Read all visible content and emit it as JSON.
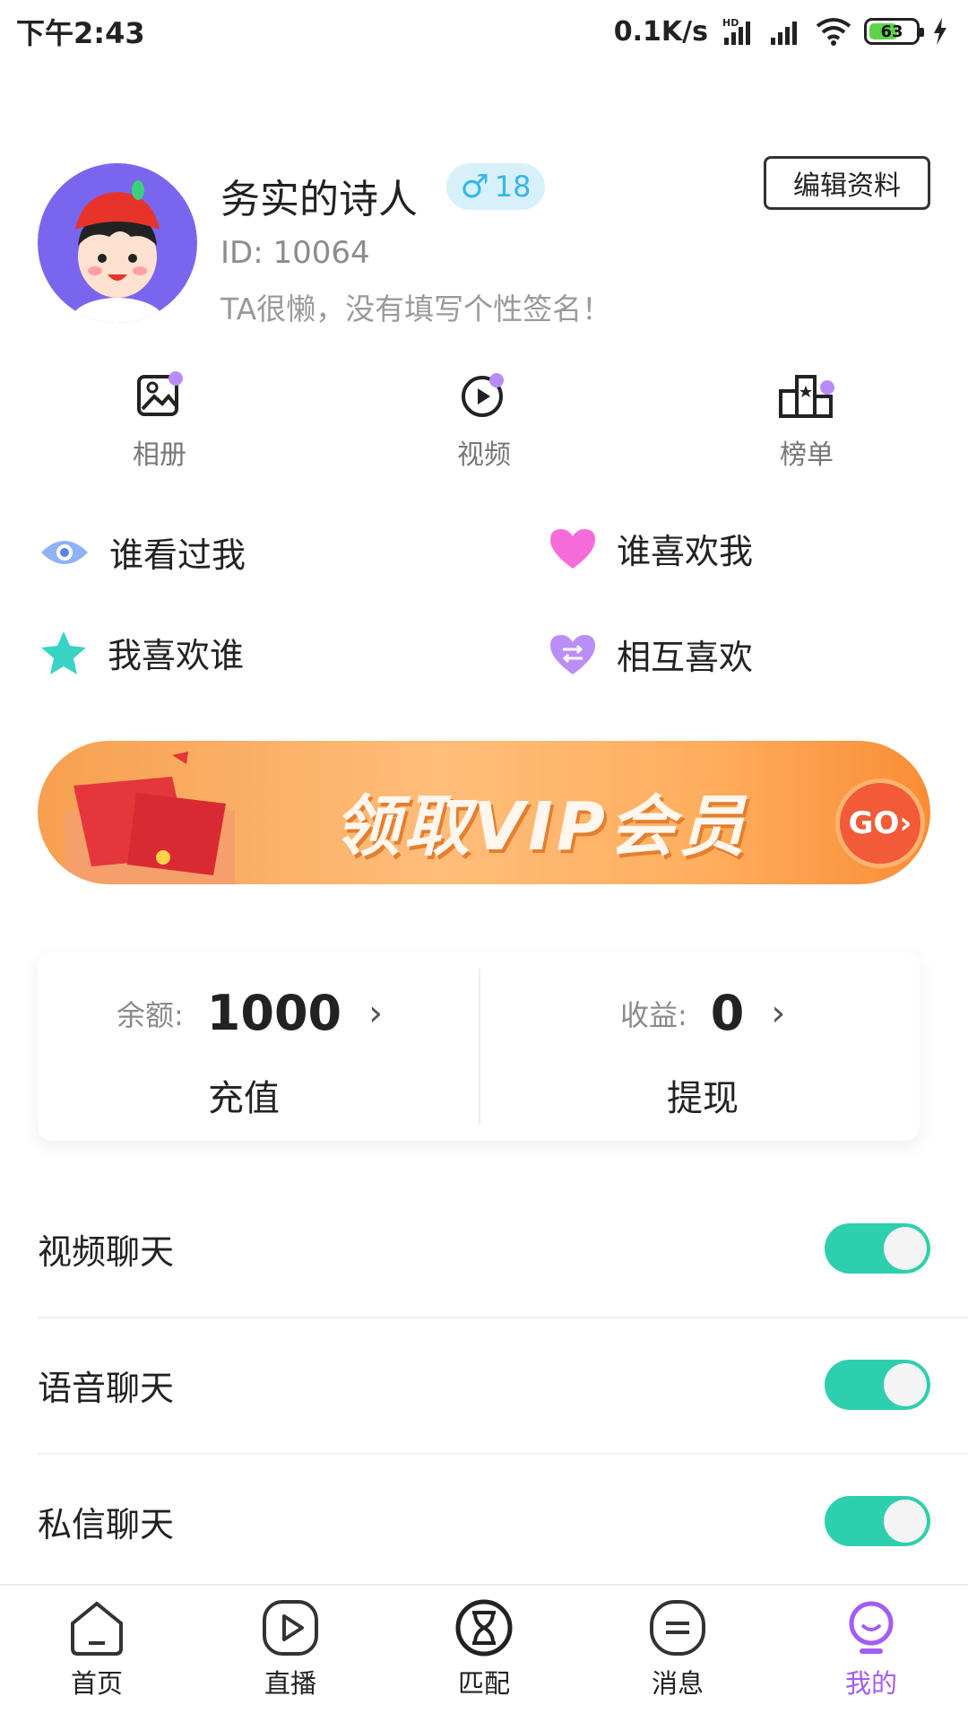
{
  "status_bar": {
    "time": "下午2:43",
    "net_speed": "0.1K/s",
    "battery": "63",
    "battery_level": 0.63
  },
  "profile": {
    "name": "务实的诗人",
    "gender_symbol": "♂",
    "age": "18",
    "id": "ID: 10064",
    "signature": "TA很懒，没有填写个性签名！",
    "edit_label": "编辑资料"
  },
  "quick_actions": [
    {
      "label": "相册",
      "icon": "album-icon"
    },
    {
      "label": "视频",
      "icon": "video-icon"
    },
    {
      "label": "榜单",
      "icon": "ranking-icon"
    }
  ],
  "menu": [
    {
      "label": "谁看过我",
      "icon": "eye-icon"
    },
    {
      "label": "谁喜欢我",
      "icon": "heart-icon"
    },
    {
      "label": "我喜欢谁",
      "icon": "star-icon"
    },
    {
      "label": "相互喜欢",
      "icon": "mutual-heart-icon"
    }
  ],
  "vip_banner": {
    "text": "领取VIP会员",
    "go_label": "GO›"
  },
  "wallet": {
    "balance_label": "余额:",
    "balance_value": "1000",
    "recharge_label": "充值",
    "earnings_label": "收益:",
    "earnings_value": "0",
    "withdraw_label": "提现",
    "chevron": "›"
  },
  "settings": [
    {
      "label": "视频聊天",
      "enabled": true
    },
    {
      "label": "语音聊天",
      "enabled": true
    },
    {
      "label": "私信聊天",
      "enabled": true
    }
  ],
  "bottom_nav": [
    {
      "label": "首页",
      "icon": "home-icon"
    },
    {
      "label": "直播",
      "icon": "live-icon"
    },
    {
      "label": "匹配",
      "icon": "match-icon"
    },
    {
      "label": "消息",
      "icon": "message-icon"
    },
    {
      "label": "我的",
      "icon": "profile-icon",
      "active": true
    }
  ],
  "colors": {
    "accent_purple": "#a35cf4",
    "toggle_on": "#2ecfae",
    "badge_blue": "#36b7ea",
    "vip_orange": "#f98d36"
  }
}
